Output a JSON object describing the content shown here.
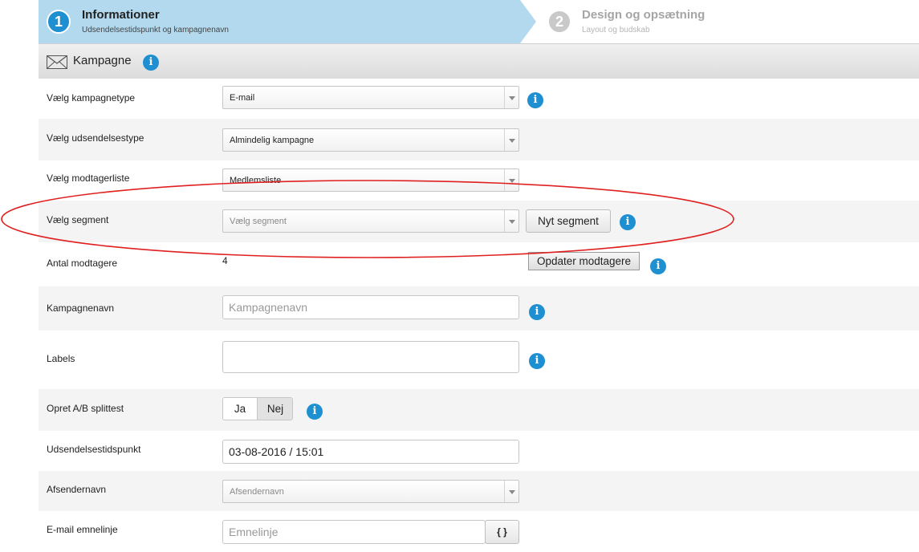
{
  "wizard": {
    "step1": {
      "number": "1",
      "title": "Informationer",
      "subtitle": "Udsendelsestidspunkt og kampagnenavn"
    },
    "step2": {
      "number": "2",
      "title": "Design og opsætning",
      "subtitle": "Layout og budskab"
    }
  },
  "section": {
    "title": "Kampagne",
    "info": "i"
  },
  "form": {
    "campaign_type": {
      "label": "Vælg kampagnetype",
      "value": "E-mail"
    },
    "send_type": {
      "label": "Vælg udsendelsestype",
      "value": "Almindelig kampagne"
    },
    "recipient_list": {
      "label": "Vælg modtagerliste",
      "value": "Medlemsliste"
    },
    "segment": {
      "label": "Vælg segment",
      "placeholder": "Vælg segment",
      "new_button": "Nyt segment"
    },
    "recipient_count": {
      "label": "Antal modtagere",
      "value": "4",
      "update_button": "Opdater modtagere"
    },
    "campaign_name": {
      "label": "Kampagnenavn",
      "placeholder": "Kampagnenavn"
    },
    "labels": {
      "label": "Labels"
    },
    "ab_split": {
      "label": "Opret A/B splittest",
      "yes": "Ja",
      "no": "Nej",
      "selected": "Nej"
    },
    "send_time": {
      "label": "Udsendelsestidspunkt",
      "value": "03-08-2016 / 15:01"
    },
    "sender_name": {
      "label": "Afsendernavn",
      "placeholder": "Afsendernavn"
    },
    "subject": {
      "label": "E-mail emnelinje",
      "placeholder": "Emnelinje",
      "merge_button": "{ }"
    }
  },
  "info_glyph": "i",
  "colors": {
    "accent": "#1e8fd1",
    "step_active_bg": "#b3d9ef",
    "highlight_ellipse": "#e02020"
  }
}
